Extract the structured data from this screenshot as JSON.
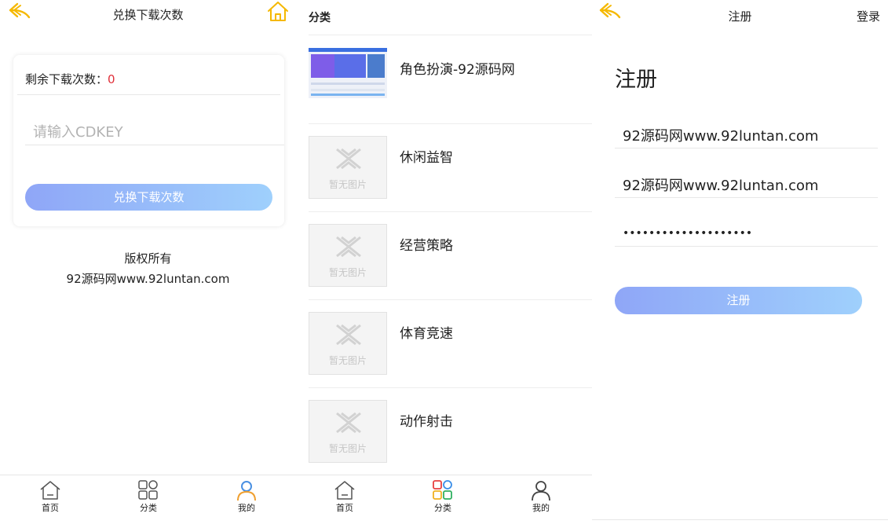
{
  "exchange_screen": {
    "title": "兑换下载次数",
    "remaining_label": "剩余下载次数：",
    "remaining_count": "0",
    "cdkey_placeholder": "请输入CDKEY",
    "exchange_button": "兑换下载次数",
    "copyright_line1": "版权所有",
    "copyright_line2": "92源码网www.92luntan.com",
    "icons": {
      "back": "back-arrow-icon",
      "home": "home-icon"
    },
    "accent_color": "#f5b800"
  },
  "category_screen": {
    "heading": "分类",
    "no_image_text": "暂无图片",
    "items": [
      {
        "label": "角色扮演-92源码网",
        "has_image": true
      },
      {
        "label": "休闲益智",
        "has_image": false
      },
      {
        "label": "经营策略",
        "has_image": false
      },
      {
        "label": "体育竞速",
        "has_image": false
      },
      {
        "label": "动作射击",
        "has_image": false
      }
    ]
  },
  "register_screen": {
    "title": "注册",
    "login_link": "登录",
    "heading": "注册",
    "field1_value": "92源码网www.92luntan.com",
    "field2_value": "92源码网www.92luntan.com",
    "password_value": "••••••••••••••••••••",
    "register_button": "注册"
  },
  "tabbar": {
    "home": "首页",
    "category": "分类",
    "mine": "我的"
  },
  "colors": {
    "button_gradient_start": "#8fa6f7",
    "button_gradient_end": "#9fd0fc",
    "count_red": "#e0303a"
  }
}
